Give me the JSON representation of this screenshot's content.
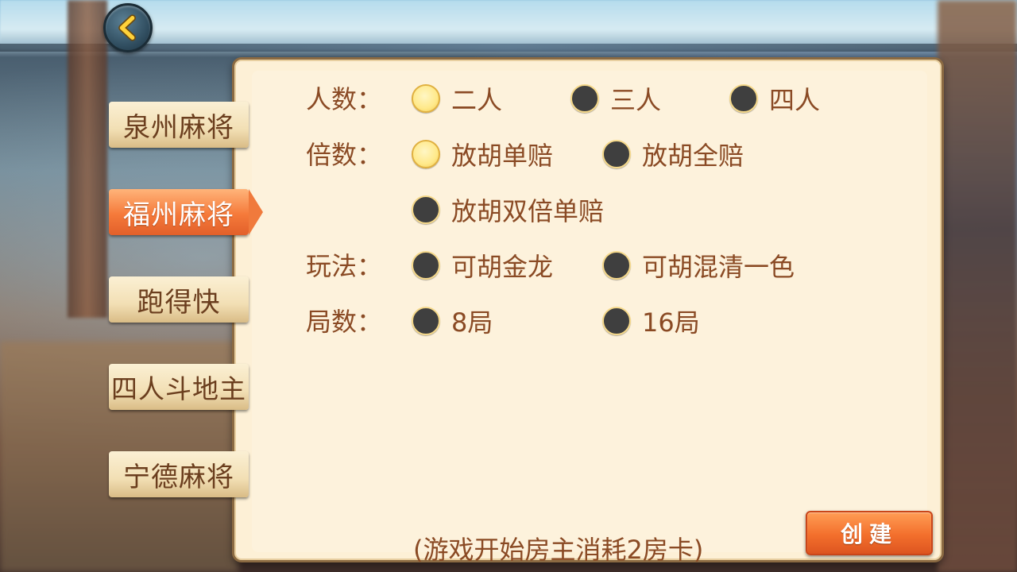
{
  "tabs": [
    {
      "label": "泉州麻将"
    },
    {
      "label": "福州麻将",
      "active": true
    },
    {
      "label": "跑得快"
    },
    {
      "label": "四人斗地主"
    },
    {
      "label": "宁德麻将"
    }
  ],
  "rows": {
    "players": {
      "label": "人数：",
      "options": [
        {
          "label": "二人",
          "selected": true
        },
        {
          "label": "三人",
          "selected": false
        },
        {
          "label": "四人",
          "selected": false
        }
      ]
    },
    "multiplier": {
      "label": "倍数：",
      "options": [
        {
          "label": "放胡单赔",
          "selected": true
        },
        {
          "label": "放胡全赔",
          "selected": false
        },
        {
          "label": "放胡双倍单赔",
          "selected": false
        }
      ]
    },
    "rules": {
      "label": "玩法：",
      "options": [
        {
          "label": "可胡金龙",
          "selected": false
        },
        {
          "label": "可胡混清一色",
          "selected": false
        }
      ]
    },
    "rounds": {
      "label": "局数：",
      "options": [
        {
          "label": "8局",
          "selected": false
        },
        {
          "label": "16局",
          "selected": false
        }
      ]
    }
  },
  "footer": {
    "note": "(游戏开始房主消耗2房卡)",
    "create_label": "创建"
  },
  "icons": {
    "back": "chevron-left-icon"
  },
  "colors": {
    "accent": "#f36f2c",
    "text": "#8a4a24",
    "panel": "#fdf0d6"
  }
}
